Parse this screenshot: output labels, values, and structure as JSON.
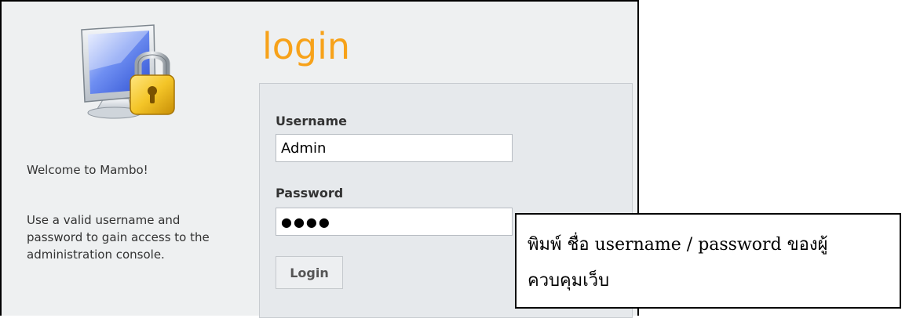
{
  "login_panel": {
    "title": "login",
    "welcome": "Welcome to Mambo!",
    "description": "Use a valid username and password to gain access to the administration console.",
    "icon": "computer-lock-icon",
    "form": {
      "username_label": "Username",
      "username_value": "Admin",
      "password_label": "Password",
      "password_value": "●●●●",
      "login_button": "Login"
    }
  },
  "callout": {
    "line1": "พิมพ์ ชื่อ username / password  ของผู้",
    "line2": "ควบคุมเว็บ"
  },
  "colors": {
    "title_accent": "#f7a21a",
    "panel_bg": "#eef0f1",
    "form_bg": "#e6e9ec"
  }
}
